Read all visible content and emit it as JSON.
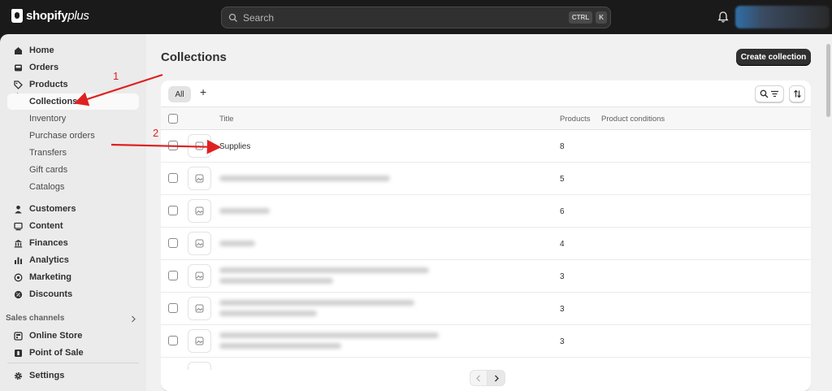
{
  "brand": {
    "name": "shopify",
    "suffix": "plus"
  },
  "search": {
    "placeholder": "Search",
    "shortcut_ctrl": "CTRL",
    "shortcut_key": "K"
  },
  "sidebar": {
    "items": [
      {
        "label": "Home",
        "icon": "home-icon"
      },
      {
        "label": "Orders",
        "icon": "inbox-icon"
      },
      {
        "label": "Products",
        "icon": "tag-icon"
      },
      {
        "label": "Collections",
        "sub": true,
        "active": true
      },
      {
        "label": "Inventory",
        "sub": true
      },
      {
        "label": "Purchase orders",
        "sub": true
      },
      {
        "label": "Transfers",
        "sub": true
      },
      {
        "label": "Gift cards",
        "sub": true
      },
      {
        "label": "Catalogs",
        "sub": true
      },
      {
        "label": "Customers",
        "icon": "person-icon"
      },
      {
        "label": "Content",
        "icon": "content-icon"
      },
      {
        "label": "Finances",
        "icon": "bank-icon"
      },
      {
        "label": "Analytics",
        "icon": "bar-chart-icon"
      },
      {
        "label": "Marketing",
        "icon": "target-icon"
      },
      {
        "label": "Discounts",
        "icon": "discount-icon"
      }
    ],
    "sales_channels_label": "Sales channels",
    "channels": [
      {
        "label": "Online Store",
        "icon": "store-icon"
      },
      {
        "label": "Point of Sale",
        "icon": "pos-icon"
      }
    ],
    "settings_label": "Settings"
  },
  "main": {
    "title": "Collections",
    "create_button": "Create collection",
    "tabs": [
      {
        "label": "All"
      }
    ],
    "add_tab": "+",
    "columns": {
      "title": "Title",
      "products": "Products",
      "conditions": "Product conditions"
    },
    "rows": [
      {
        "title": "Supplies",
        "products": "8"
      },
      {
        "title": "",
        "products": "5"
      },
      {
        "title": "",
        "products": "6"
      },
      {
        "title": "",
        "products": "4"
      },
      {
        "title": "",
        "products": "3"
      },
      {
        "title": "",
        "products": "3"
      },
      {
        "title": "",
        "products": "3"
      }
    ]
  },
  "annotations": {
    "one": "1",
    "two": "2",
    "color": "#e02020"
  }
}
